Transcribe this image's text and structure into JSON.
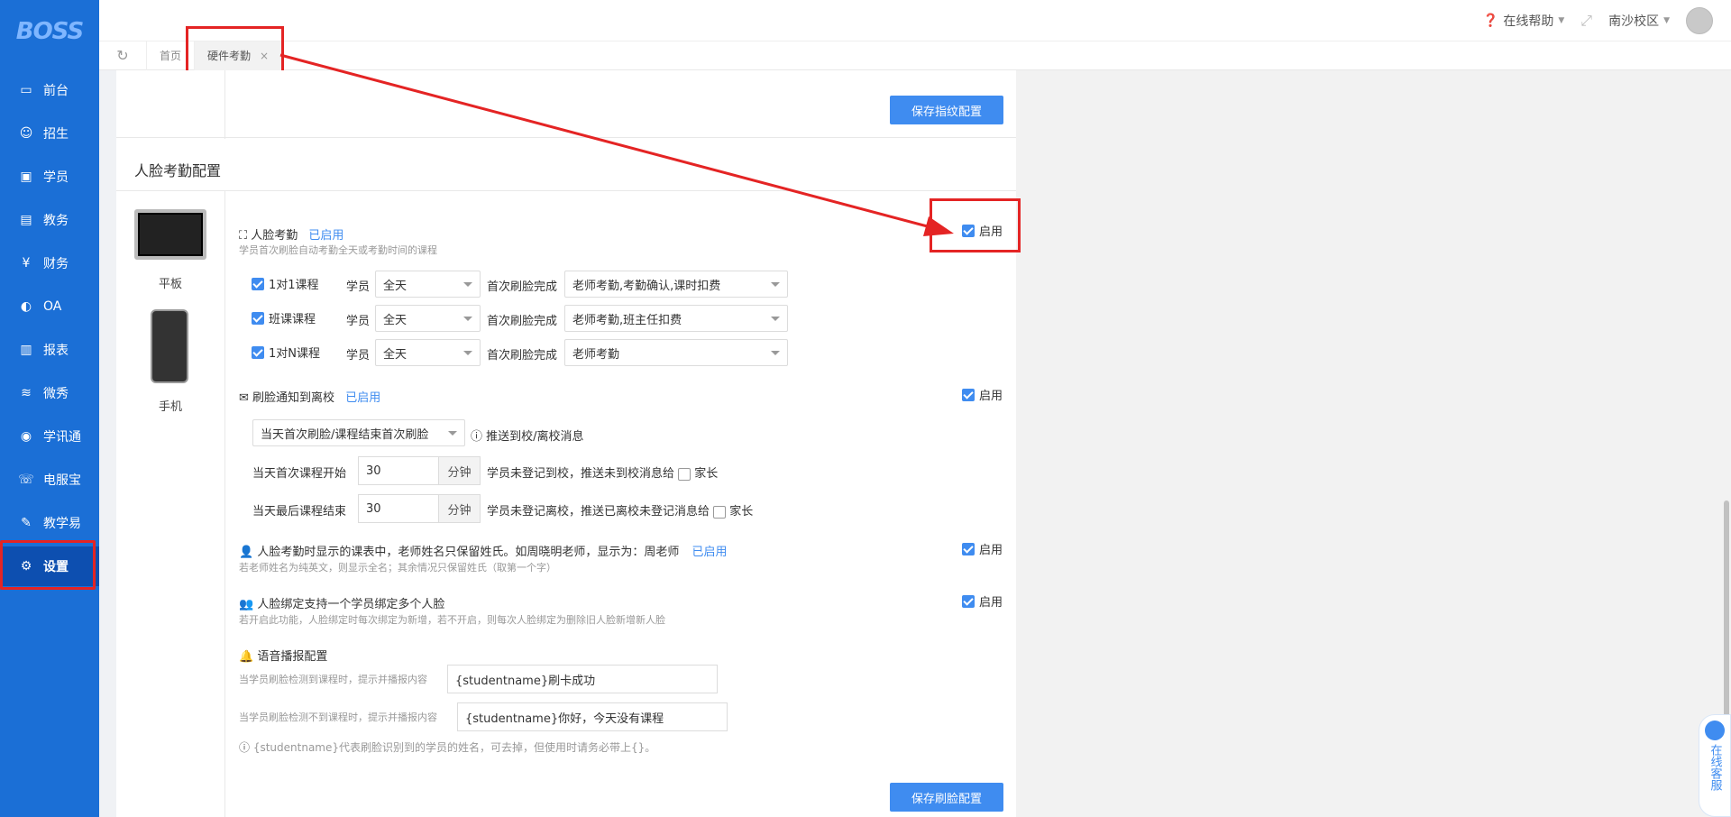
{
  "brand": {
    "logo": "BOSS"
  },
  "sidebar": {
    "items": [
      {
        "label": "前台",
        "icon": "calendar-icon"
      },
      {
        "label": "招生",
        "icon": "user-add-icon"
      },
      {
        "label": "学员",
        "icon": "id-card-icon"
      },
      {
        "label": "教务",
        "icon": "book-icon"
      },
      {
        "label": "财务",
        "icon": "yen-icon"
      },
      {
        "label": "OA",
        "icon": "toggle-icon"
      },
      {
        "label": "报表",
        "icon": "bar-chart-icon"
      },
      {
        "label": "微秀",
        "icon": "wave-icon"
      },
      {
        "label": "学讯通",
        "icon": "location-icon"
      },
      {
        "label": "电服宝",
        "icon": "phone-icon"
      },
      {
        "label": "教学易",
        "icon": "teach-icon"
      },
      {
        "label": "设置",
        "icon": "gear-icon"
      }
    ],
    "active_index": 11
  },
  "topbar": {
    "help": "在线帮助",
    "campus": "南沙校区"
  },
  "tabs": [
    {
      "label": "首页"
    },
    {
      "label": "硬件考勤",
      "close": "×"
    }
  ],
  "buttons": {
    "save_fingerprint": "保存指纹配置",
    "save_face": "保存刷脸配置"
  },
  "section": {
    "title": "人脸考勤配置"
  },
  "devices": {
    "tablet": "平板",
    "phone": "手机"
  },
  "face": {
    "title": "人脸考勤",
    "status": "已启用",
    "desc": "学员首次刷脸自动考勤全天或考勤时间的课程",
    "enable_label": "启用",
    "rows": [
      {
        "course": "1对1课程",
        "who": "学员",
        "time": "全天",
        "after": "首次刷脸完成",
        "action": "老师考勤,考勤确认,课时扣费"
      },
      {
        "course": "班课课程",
        "who": "学员",
        "time": "全天",
        "after": "首次刷脸完成",
        "action": "老师考勤,班主任扣费"
      },
      {
        "course": "1对N课程",
        "who": "学员",
        "time": "全天",
        "after": "首次刷脸完成",
        "action": "老师考勤"
      }
    ]
  },
  "notify": {
    "title": "刷脸通知到离校",
    "status": "已启用",
    "enable_label": "启用",
    "mode": "当天首次刷脸/课程结束首次刷脸",
    "mode_hint": "推送到校/离校消息",
    "start_label": "当天首次课程开始",
    "start_value": "30",
    "start_unit": "分钟",
    "start_desc": "学员未登记到校，推送未到校消息给",
    "start_target": "家长",
    "end_label": "当天最后课程结束",
    "end_value": "30",
    "end_unit": "分钟",
    "end_desc": "学员未登记离校，推送已离校未登记消息给",
    "end_target": "家长"
  },
  "surname": {
    "title": "人脸考勤时显示的课表中，老师姓名只保留姓氏。如周晓明老师，显示为：周老师",
    "status": "已启用",
    "desc": "若老师姓名为纯英文，则显示全名；其余情况只保留姓氏（取第一个字）",
    "enable_label": "启用"
  },
  "multi": {
    "title": "人脸绑定支持一个学员绑定多个人脸",
    "desc": "若开启此功能，人脸绑定时每次绑定为新增，若不开启，则每次人脸绑定为删除旧人脸新增新人脸",
    "enable_label": "启用"
  },
  "voice": {
    "title": "语音播报配置",
    "hit_label": "当学员刷脸检测到课程时，提示并播报内容",
    "hit_value": "{studentname}刷卡成功",
    "miss_label": "当学员刷脸检测不到课程时，提示并播报内容",
    "miss_value": "{studentname}你好，今天没有课程",
    "note": "{studentname}代表刷脸识别到的学员的姓名，可去掉，但使用时请务必带上{}。"
  },
  "service": {
    "label": "在线客服"
  },
  "colors": {
    "sidebar": "#1b6fd6",
    "primary": "#3f8cf0",
    "annotation": "#e42424"
  }
}
